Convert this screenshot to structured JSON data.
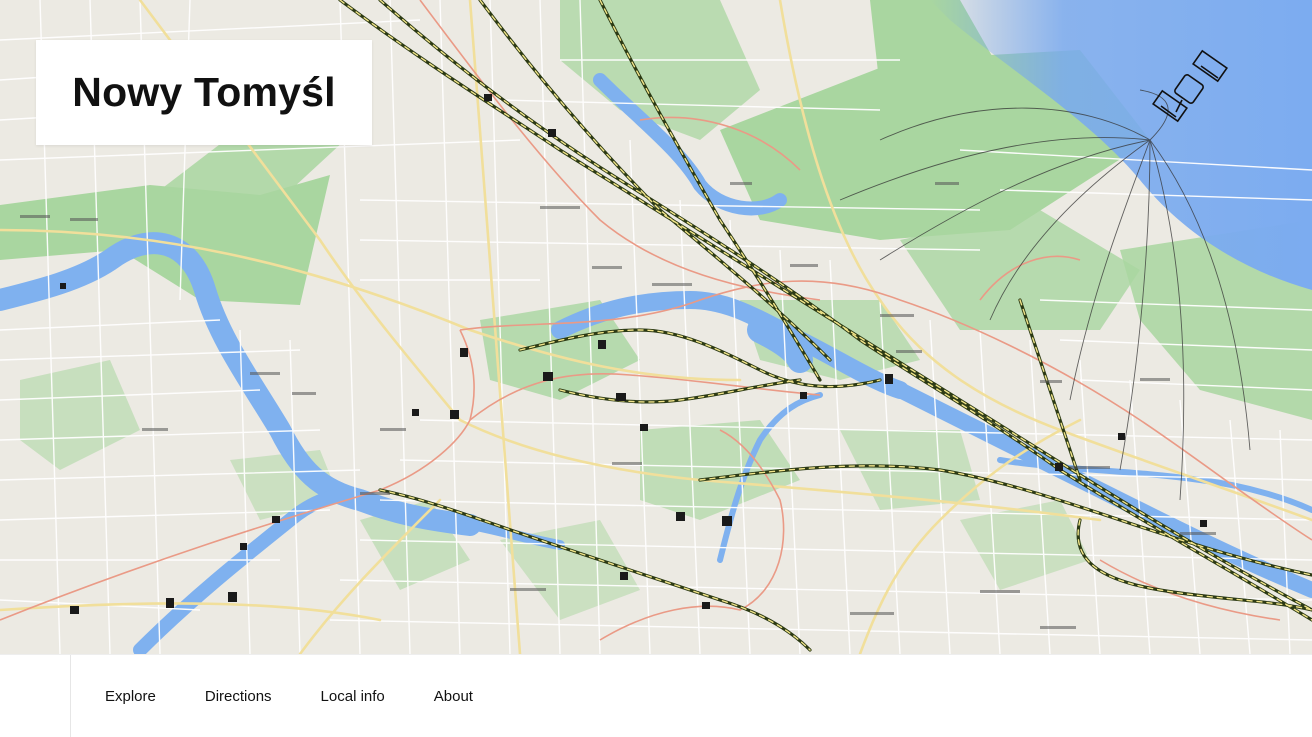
{
  "place": {
    "title": "Nowy Tomyśl"
  },
  "nav": {
    "items": [
      {
        "label": "Explore"
      },
      {
        "label": "Directions"
      },
      {
        "label": "Local info"
      },
      {
        "label": "About"
      }
    ]
  },
  "map": {
    "colors": {
      "land": "#eceae3",
      "park": "#a9d6a0",
      "water": "#7fb1ef",
      "river": "#6fa2e8",
      "road": "#ffffff",
      "major_road": "#f1df9b",
      "rail": "#2c3a14",
      "rail_dash": "#f1e48a",
      "route": "#ea9a86"
    },
    "icons": [
      "satellite-icon"
    ]
  }
}
